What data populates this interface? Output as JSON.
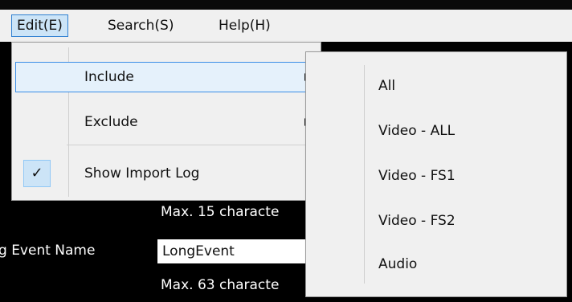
{
  "menubar": {
    "items": [
      {
        "label": "Edit(E)"
      },
      {
        "label": "Search(S)"
      },
      {
        "label": "Help(H)"
      }
    ]
  },
  "edit_menu": {
    "items": [
      {
        "label": "Include",
        "has_submenu": true
      },
      {
        "label": "Exclude",
        "has_submenu": true
      },
      {
        "label": "Show Import Log",
        "checked": true
      }
    ]
  },
  "include_submenu": {
    "items": [
      {
        "label": "All"
      },
      {
        "label": "Video - ALL"
      },
      {
        "label": "Video - FS1"
      },
      {
        "label": "Video - FS2"
      },
      {
        "label": "Audio"
      }
    ]
  },
  "background": {
    "hint_1": "Max. 15 characte",
    "event_name_label": "g Event Name",
    "event_name_value": "LongEvent",
    "hint_2": "Max. 63 characte"
  },
  "colors": {
    "menu_bg": "#f0f0f0",
    "highlight_bg": "#cce4f7",
    "highlight_border": "#3a8ee6",
    "app_bg": "#000000"
  }
}
